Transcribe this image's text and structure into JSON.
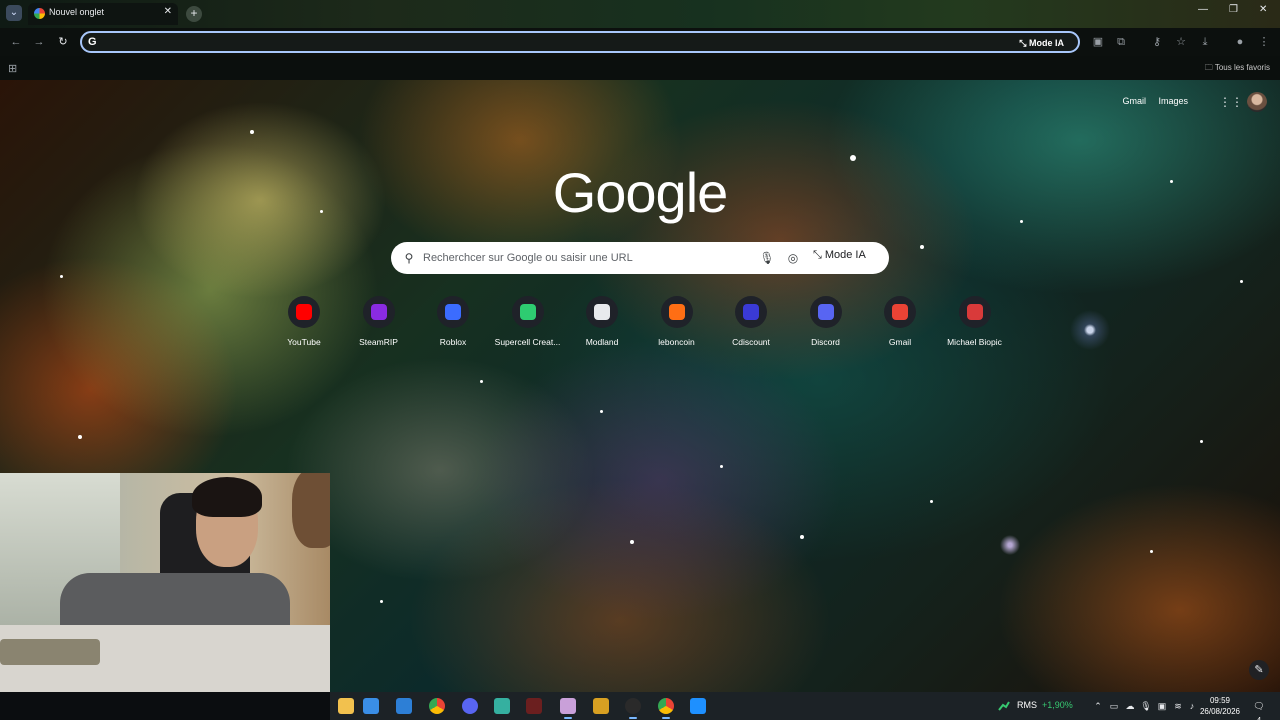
{
  "browser": {
    "tab": {
      "title": "Nouvel onglet",
      "close": "✕"
    },
    "new_tab": "+",
    "window_controls": {
      "minimize": "—",
      "maximize": "❐",
      "close": "✕"
    },
    "omnibox": {
      "g_label": "G",
      "mode_label": "Mode IA"
    },
    "bookmarks": {
      "all_label": "Tous les favoris"
    }
  },
  "ntp": {
    "links": {
      "gmail": "Gmail",
      "images": "Images"
    },
    "logo": "Google",
    "search": {
      "placeholder": "Recherchcer sur Google ou saisir une URL",
      "mode_label": "Mode IA"
    },
    "shortcuts": [
      {
        "label": "YouTube",
        "color": "#ff0000"
      },
      {
        "label": "SteamRIP",
        "color": "#8a2be2"
      },
      {
        "label": "Roblox",
        "color": "#3b6cff"
      },
      {
        "label": "Supercell Creat...",
        "color": "#2ecc71"
      },
      {
        "label": "Modland",
        "color": "#e8eaed"
      },
      {
        "label": "leboncoin",
        "color": "#ff6e14"
      },
      {
        "label": "Cdiscount",
        "color": "#3a3ad6"
      },
      {
        "label": "Discord",
        "color": "#5865f2"
      },
      {
        "label": "Gmail",
        "color": "#ea4335"
      },
      {
        "label": "Michael Biopic",
        "color": "#d93a3a"
      }
    ]
  },
  "taskbar": {
    "stock": {
      "name": "RMS",
      "change": "+1,90%"
    },
    "clock": {
      "time": "09:59",
      "date": "26/08/2026"
    },
    "notifications": "4"
  },
  "colors": {
    "accent": "#a8c7fa",
    "positive": "#37c871"
  }
}
